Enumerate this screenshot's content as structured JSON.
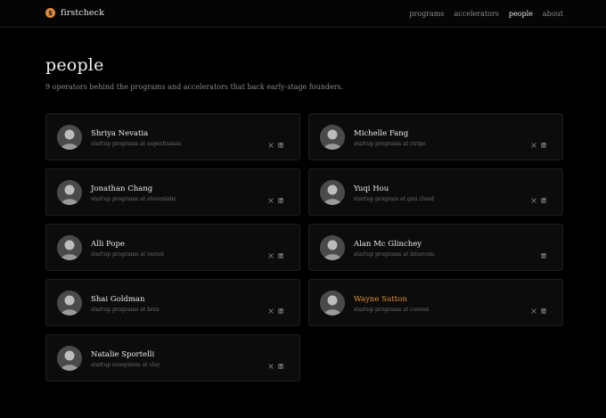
{
  "header": {
    "brand_name": "firstcheck",
    "brand_glyph": "$",
    "nav": [
      {
        "label": "programs",
        "active": false
      },
      {
        "label": "accelerators",
        "active": false
      },
      {
        "label": "people",
        "active": true
      },
      {
        "label": "about",
        "active": false
      }
    ]
  },
  "page": {
    "title": "people",
    "subtitle": "9 operators behind the programs and accelerators that back early-stage founders."
  },
  "people": [
    {
      "name": "Shriya Nevatia",
      "role": "startup programs at superhuman",
      "x": true,
      "linkedin": true,
      "accent": false
    },
    {
      "name": "Michelle Fang",
      "role": "startup programs at stripe",
      "x": true,
      "linkedin": true,
      "accent": false
    },
    {
      "name": "Jonathan Chang",
      "role": "startup programs at elevenlabs",
      "x": true,
      "linkedin": true,
      "accent": false
    },
    {
      "name": "Yuqi Hou",
      "role": "startup program at gmi cloud",
      "x": true,
      "linkedin": true,
      "accent": false
    },
    {
      "name": "Alli Pope",
      "role": "startup programs at vercel",
      "x": true,
      "linkedin": true,
      "accent": false
    },
    {
      "name": "Alan Mc Glinchey",
      "role": "startup programs at intercom",
      "x": false,
      "linkedin": true,
      "accent": false
    },
    {
      "name": "Shai Goldman",
      "role": "startup programs at brex",
      "x": true,
      "linkedin": true,
      "accent": false
    },
    {
      "name": "Wayne Sutton",
      "role": "startup programs at convex",
      "x": true,
      "linkedin": true,
      "accent": true
    },
    {
      "name": "Natalie Sportelli",
      "role": "startup ecosystem at clay",
      "x": true,
      "linkedin": true,
      "accent": false
    }
  ],
  "colors": {
    "accent": "#e0913e",
    "background": "#000000",
    "card": "#0c0c0c",
    "border": "#1f1f1f"
  },
  "icons": {
    "brand": "dollar-coin-icon",
    "x": "x-logo-icon",
    "linkedin": "linkedin-icon",
    "avatar": "avatar-photo-icon"
  }
}
